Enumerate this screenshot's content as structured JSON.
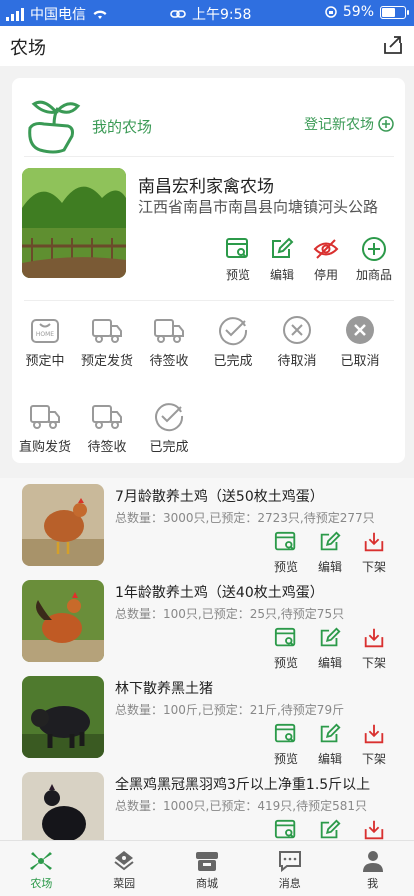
{
  "status_bar": {
    "carrier": "中国电信",
    "time": "上午9:58",
    "battery": "59%",
    "battery_level": 0.59
  },
  "nav": {
    "title": "农场"
  },
  "my_farm": {
    "label": "我的农场",
    "register": "登记新农场"
  },
  "farm": {
    "name": "南昌宏利家禽农场",
    "address": "江西省南昌市南昌县向塘镇河头公路",
    "actions": [
      "预览",
      "编辑",
      "停用",
      "加商品"
    ]
  },
  "order_status": {
    "reserve": [
      "预定中",
      "预定发货",
      "待签收",
      "已完成",
      "待取消",
      "已取消"
    ],
    "direct": [
      "直购发货",
      "待签收",
      "已完成"
    ],
    "icon_label": "HOME"
  },
  "products": [
    {
      "name": "7月龄散养土鸡（送50枚土鸡蛋）",
      "stats": "总数量：3000只,已预定：2723只,待预定277只"
    },
    {
      "name": "1年龄散养土鸡（送40枚土鸡蛋）",
      "stats": "总数量：100只,已预定：25只,待预定75只"
    },
    {
      "name": "林下散养黑土猪",
      "stats": "总数量：100斤,已预定：21斤,待预定79斤"
    },
    {
      "name": "全黑鸡黑冠黑羽鸡3斤以上净重1.5斤以上",
      "stats": "总数量：1000只,已预定：419只,待预定581只"
    }
  ],
  "product_actions": [
    "预览",
    "编辑",
    "下架"
  ],
  "tabbar": [
    "农场",
    "菜园",
    "商城",
    "消息",
    "我"
  ],
  "colors": {
    "status_bar": "#2f6fe0",
    "green": "#2c9a4a",
    "red": "#d9302f",
    "gray_icon": "#9a9a9a"
  }
}
